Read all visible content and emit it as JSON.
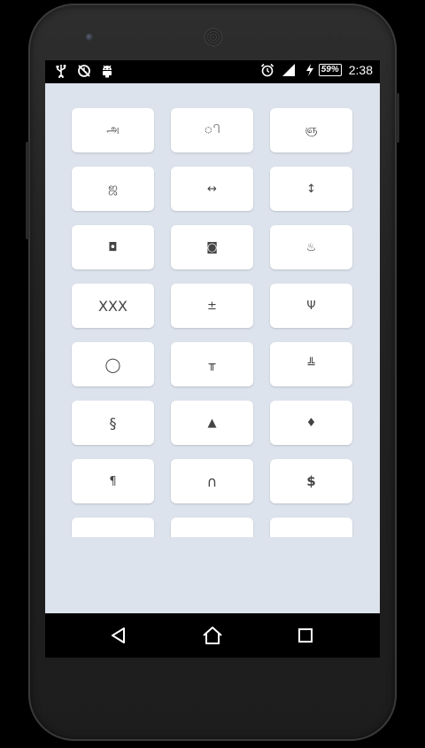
{
  "status_bar": {
    "left_icons": [
      "usb-icon",
      "no-sync-icon",
      "android-debug-icon"
    ],
    "right_icons": [
      "alarm-icon",
      "signal-icon",
      "charging-icon"
    ],
    "battery_level": "59%",
    "time": "2:38"
  },
  "keys": [
    "அ",
    "ி",
    "ஞ",
    "ஜ",
    "↔",
    "↕",
    "◘",
    "◙",
    "♨",
    "XXX",
    "±",
    "Ψ",
    "◯",
    "╥",
    "╩",
    "§",
    "▲",
    "♦",
    "¶",
    "∩",
    "$",
    "",
    "",
    ""
  ],
  "nav_bar": {
    "buttons": [
      "back-icon",
      "home-icon",
      "recent-apps-icon"
    ]
  },
  "colors": {
    "app_background": "#dde3ec",
    "key_background": "#ffffff",
    "key_text": "#444444"
  }
}
